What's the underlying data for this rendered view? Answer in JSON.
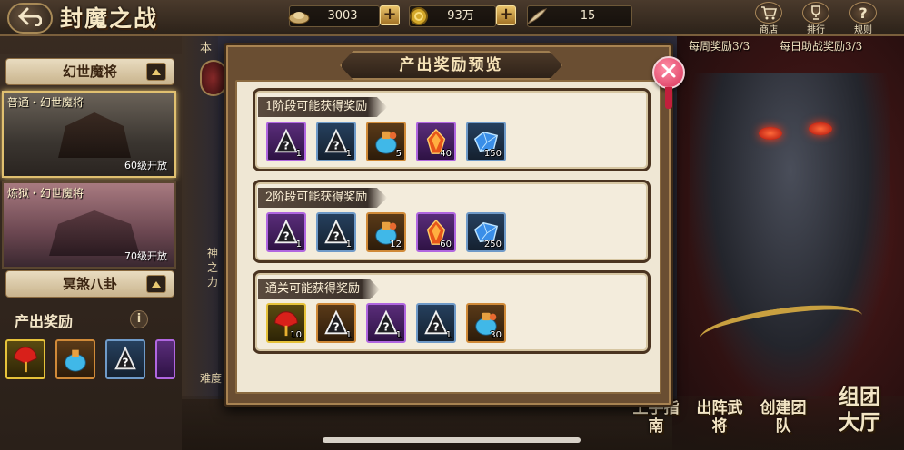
{
  "header": {
    "title": "封魔之战",
    "resources": [
      {
        "name": "silver-ingot",
        "value": "3003",
        "color": "#d9c08a"
      },
      {
        "name": "gold-coin",
        "value": "93万",
        "color": "#d4a82a"
      },
      {
        "name": "feather-token",
        "value": "15",
        "color": "#d8c49a"
      }
    ],
    "nav_icons": [
      {
        "label": "商店",
        "icon": "shop-cart-icon"
      },
      {
        "label": "排行",
        "icon": "trophy-icon"
      },
      {
        "label": "规则",
        "icon": "question-icon"
      }
    ]
  },
  "quota": {
    "weekly": "每周奖励3/3",
    "assist": "每日助战奖励3/3",
    "left_tab": "本"
  },
  "left_panel": {
    "section1_title": "幻世魔将",
    "stages": [
      {
        "name": "普通・幻世魔将",
        "unlock": "60级开放",
        "active": true
      },
      {
        "name": "炼狱・幻世魔将",
        "unlock": "70级开放",
        "active": false
      }
    ],
    "section2_title": "冥煞八卦",
    "reward_label": "产出奖励",
    "info_icon": "i"
  },
  "mid_panel": {
    "text_lines": [
      "神",
      "之",
      "力"
    ],
    "difficulty_label": "难度"
  },
  "modal": {
    "title": "产出奖励预览",
    "stages": [
      {
        "title": "1阶段可能获得奖励",
        "items": [
          {
            "icon": "mystery-scroll-icon",
            "rarity": "purple",
            "count": "1"
          },
          {
            "icon": "mystery-scroll-icon",
            "rarity": "blue",
            "count": "1"
          },
          {
            "icon": "potion-bag-icon",
            "rarity": "orange",
            "count": "5"
          },
          {
            "icon": "fire-crystal-icon",
            "rarity": "purple",
            "count": "40"
          },
          {
            "icon": "blue-crystal-icon",
            "rarity": "blue",
            "count": "150"
          }
        ]
      },
      {
        "title": "2阶段可能获得奖励",
        "items": [
          {
            "icon": "mystery-scroll-icon",
            "rarity": "purple",
            "count": "1"
          },
          {
            "icon": "mystery-scroll-icon",
            "rarity": "blue",
            "count": "1"
          },
          {
            "icon": "potion-bag-icon",
            "rarity": "orange",
            "count": "12"
          },
          {
            "icon": "fire-crystal-icon",
            "rarity": "purple",
            "count": "60"
          },
          {
            "icon": "blue-crystal-icon",
            "rarity": "blue",
            "count": "250"
          }
        ]
      },
      {
        "title": "通关可能获得奖励",
        "items": [
          {
            "icon": "red-fan-icon",
            "rarity": "gold",
            "count": "10"
          },
          {
            "icon": "mystery-scroll-icon",
            "rarity": "orange",
            "count": "1"
          },
          {
            "icon": "mystery-scroll-icon",
            "rarity": "purple",
            "count": "1"
          },
          {
            "icon": "mystery-scroll-icon",
            "rarity": "blue",
            "count": "1"
          },
          {
            "icon": "potion-bag-icon",
            "rarity": "orange",
            "count": "30"
          }
        ]
      }
    ]
  },
  "bottom_buttons": [
    {
      "label": "上手指南"
    },
    {
      "label": "出阵武将"
    },
    {
      "label": "创建团队"
    },
    {
      "label": "组团大厅"
    }
  ]
}
